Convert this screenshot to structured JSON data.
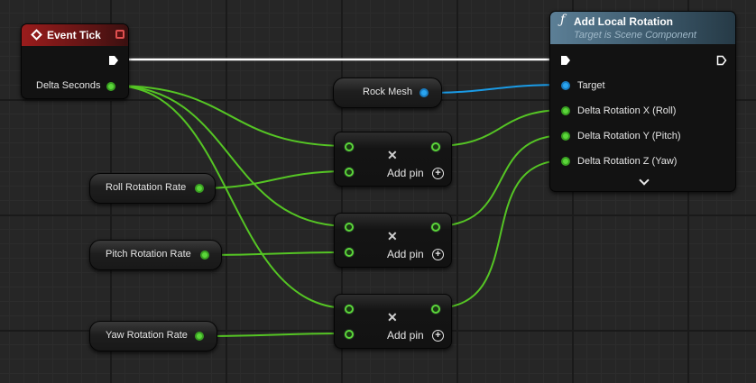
{
  "colors": {
    "float_wire": "#55c524",
    "object_wire": "#1a9be6",
    "exec_wire": "#ffffff",
    "event_header": "#9a1c1c",
    "function_header": "#5c7f96"
  },
  "event_tick": {
    "title": "Event Tick",
    "output_pin": "Delta Seconds"
  },
  "add_local_rotation": {
    "title": "Add Local Rotation",
    "subtitle": "Target is Scene Component",
    "pins": {
      "target": "Target",
      "roll": "Delta Rotation X (Roll)",
      "pitch": "Delta Rotation Y (Pitch)",
      "yaw": "Delta Rotation Z (Yaw)"
    }
  },
  "variables": {
    "rock_mesh": "Rock Mesh",
    "roll_rate": "Roll Rotation Rate",
    "pitch_rate": "Pitch Rotation Rate",
    "yaw_rate": "Yaw Rotation Rate"
  },
  "multiply_nodes": [
    {
      "symbol": "✕",
      "add_pin_label": "Add pin",
      "add_pin_icon": "+"
    },
    {
      "symbol": "✕",
      "add_pin_label": "Add pin",
      "add_pin_icon": "+"
    },
    {
      "symbol": "✕",
      "add_pin_label": "Add pin",
      "add_pin_icon": "+"
    }
  ]
}
